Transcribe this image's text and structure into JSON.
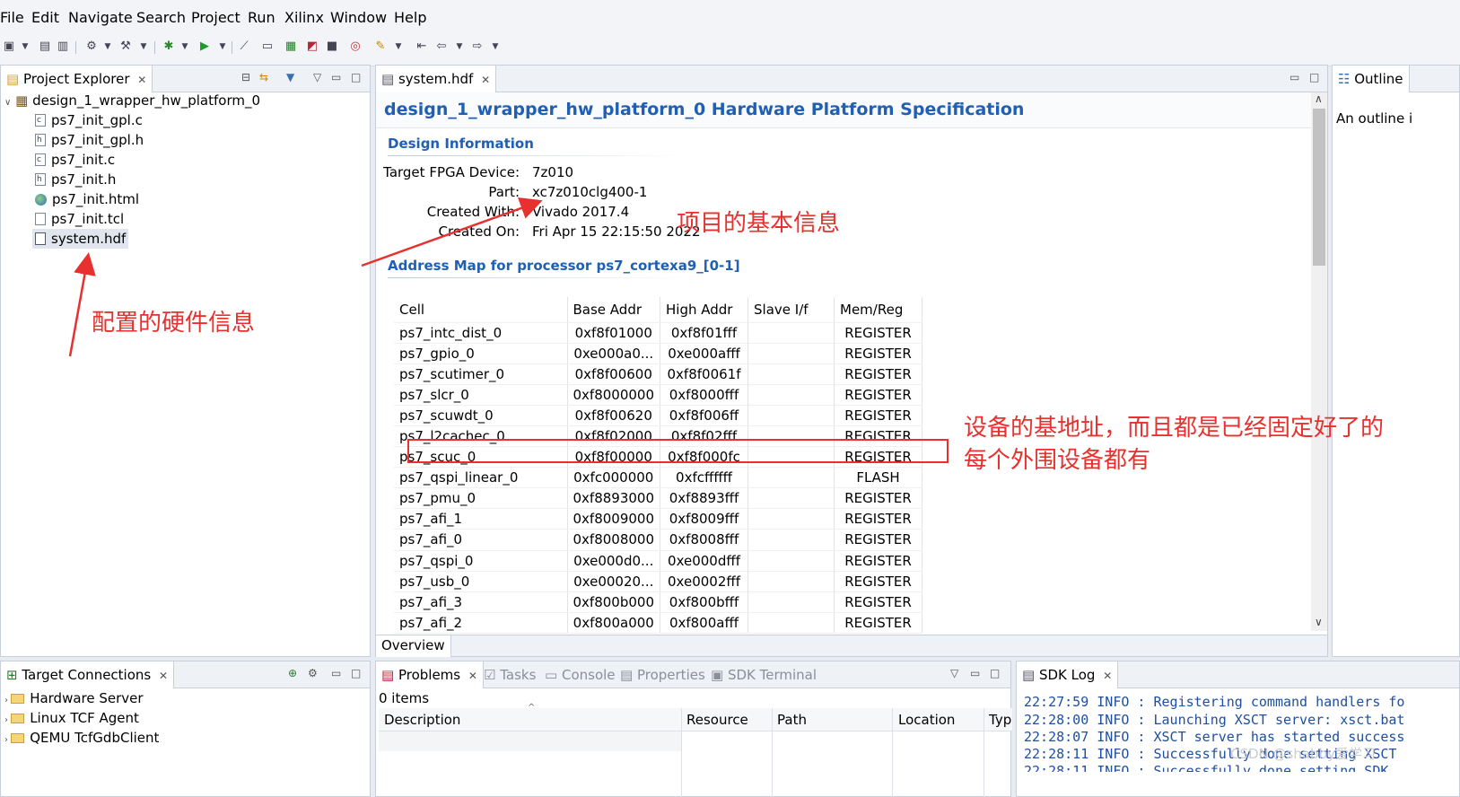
{
  "menu": [
    "File",
    "Edit",
    "Navigate",
    "Search",
    "Project",
    "Run",
    "Xilinx",
    "Window",
    "Help"
  ],
  "project_explorer": {
    "tab": "Project Explorer",
    "root": "design_1_wrapper_hw_platform_0",
    "files": [
      "ps7_init_gpl.c",
      "ps7_init_gpl.h",
      "ps7_init.c",
      "ps7_init.h",
      "ps7_init.html",
      "ps7_init.tcl",
      "system.hdf"
    ]
  },
  "editor": {
    "tab": "system.hdf",
    "title": "design_1_wrapper_hw_platform_0 Hardware Platform Specification",
    "design_info_heading": "Design Information",
    "design_info": [
      {
        "label": "Target FPGA Device:",
        "value": "7z010"
      },
      {
        "label": "Part:",
        "value": "xc7z010clg400-1"
      },
      {
        "label": "Created With:",
        "value": "Vivado 2017.4"
      },
      {
        "label": "Created On:",
        "value": "Fri Apr 15 22:15:50 2022"
      }
    ],
    "address_map_heading": "Address Map for processor ps7_cortexa9_[0-1]",
    "columns": [
      "Cell",
      "Base Addr",
      "High Addr",
      "Slave I/f",
      "Mem/Reg"
    ],
    "rows": [
      [
        "ps7_intc_dist_0",
        "0xf8f01000",
        "0xf8f01fff",
        "",
        "REGISTER"
      ],
      [
        "ps7_gpio_0",
        "0xe000a0...",
        "0xe000afff",
        "",
        "REGISTER"
      ],
      [
        "ps7_scutimer_0",
        "0xf8f00600",
        "0xf8f0061f",
        "",
        "REGISTER"
      ],
      [
        "ps7_slcr_0",
        "0xf8000000",
        "0xf8000fff",
        "",
        "REGISTER"
      ],
      [
        "ps7_scuwdt_0",
        "0xf8f00620",
        "0xf8f006ff",
        "",
        "REGISTER"
      ],
      [
        "ps7_l2cachec_0",
        "0xf8f02000",
        "0xf8f02fff",
        "",
        "REGISTER"
      ],
      [
        "ps7_scuc_0",
        "0xf8f00000",
        "0xf8f000fc",
        "",
        "REGISTER"
      ],
      [
        "ps7_qspi_linear_0",
        "0xfc000000",
        "0xfcffffff",
        "",
        "FLASH"
      ],
      [
        "ps7_pmu_0",
        "0xf8893000",
        "0xf8893fff",
        "",
        "REGISTER"
      ],
      [
        "ps7_afi_1",
        "0xf8009000",
        "0xf8009fff",
        "",
        "REGISTER"
      ],
      [
        "ps7_afi_0",
        "0xf8008000",
        "0xf8008fff",
        "",
        "REGISTER"
      ],
      [
        "ps7_qspi_0",
        "0xe000d0...",
        "0xe000dfff",
        "",
        "REGISTER"
      ],
      [
        "ps7_usb_0",
        "0xe00020...",
        "0xe0002fff",
        "",
        "REGISTER"
      ],
      [
        "ps7_afi_3",
        "0xf800b000",
        "0xf800bfff",
        "",
        "REGISTER"
      ],
      [
        "ps7_afi_2",
        "0xf800a000",
        "0xf800afff",
        "",
        "REGISTER"
      ]
    ],
    "bottom_tab": "Overview"
  },
  "outline": {
    "tab": "Outline",
    "text": "An outline i"
  },
  "target_connections": {
    "tab": "Target Connections",
    "items": [
      "Hardware Server",
      "Linux TCF Agent",
      "QEMU TcfGdbClient"
    ]
  },
  "problems": {
    "tabs": [
      "Problems",
      "Tasks",
      "Console",
      "Properties",
      "SDK Terminal"
    ],
    "count": "0 items",
    "columns": [
      "Description",
      "Resource",
      "Path",
      "Location",
      "Typ"
    ]
  },
  "sdk_log": {
    "tab": "SDK Log",
    "lines": [
      "22:27:59 INFO   : Registering command handlers fo",
      "22:28:00 INFO   : Launching XSCT server: xsct.bat",
      "22:28:07 INFO   : XSCT server has started success",
      "22:28:11 INFO   : Successfully done setting XSCT ",
      "22:28:11 INFO   : Successfully done setting SDK "
    ]
  },
  "annotations": {
    "project_info": "项目的基本信息",
    "hardware_info": "配置的硬件信息",
    "base_addr_line1": "设备的基地址，而且都是已经固定好了的",
    "base_addr_line2": "每个外围设备都有"
  },
  "watermark": "CSDN @shabby爱学习",
  "colors": {
    "accent": "#1f5fb4",
    "annotation": "#e8312f",
    "log": "#1f4fa0"
  }
}
